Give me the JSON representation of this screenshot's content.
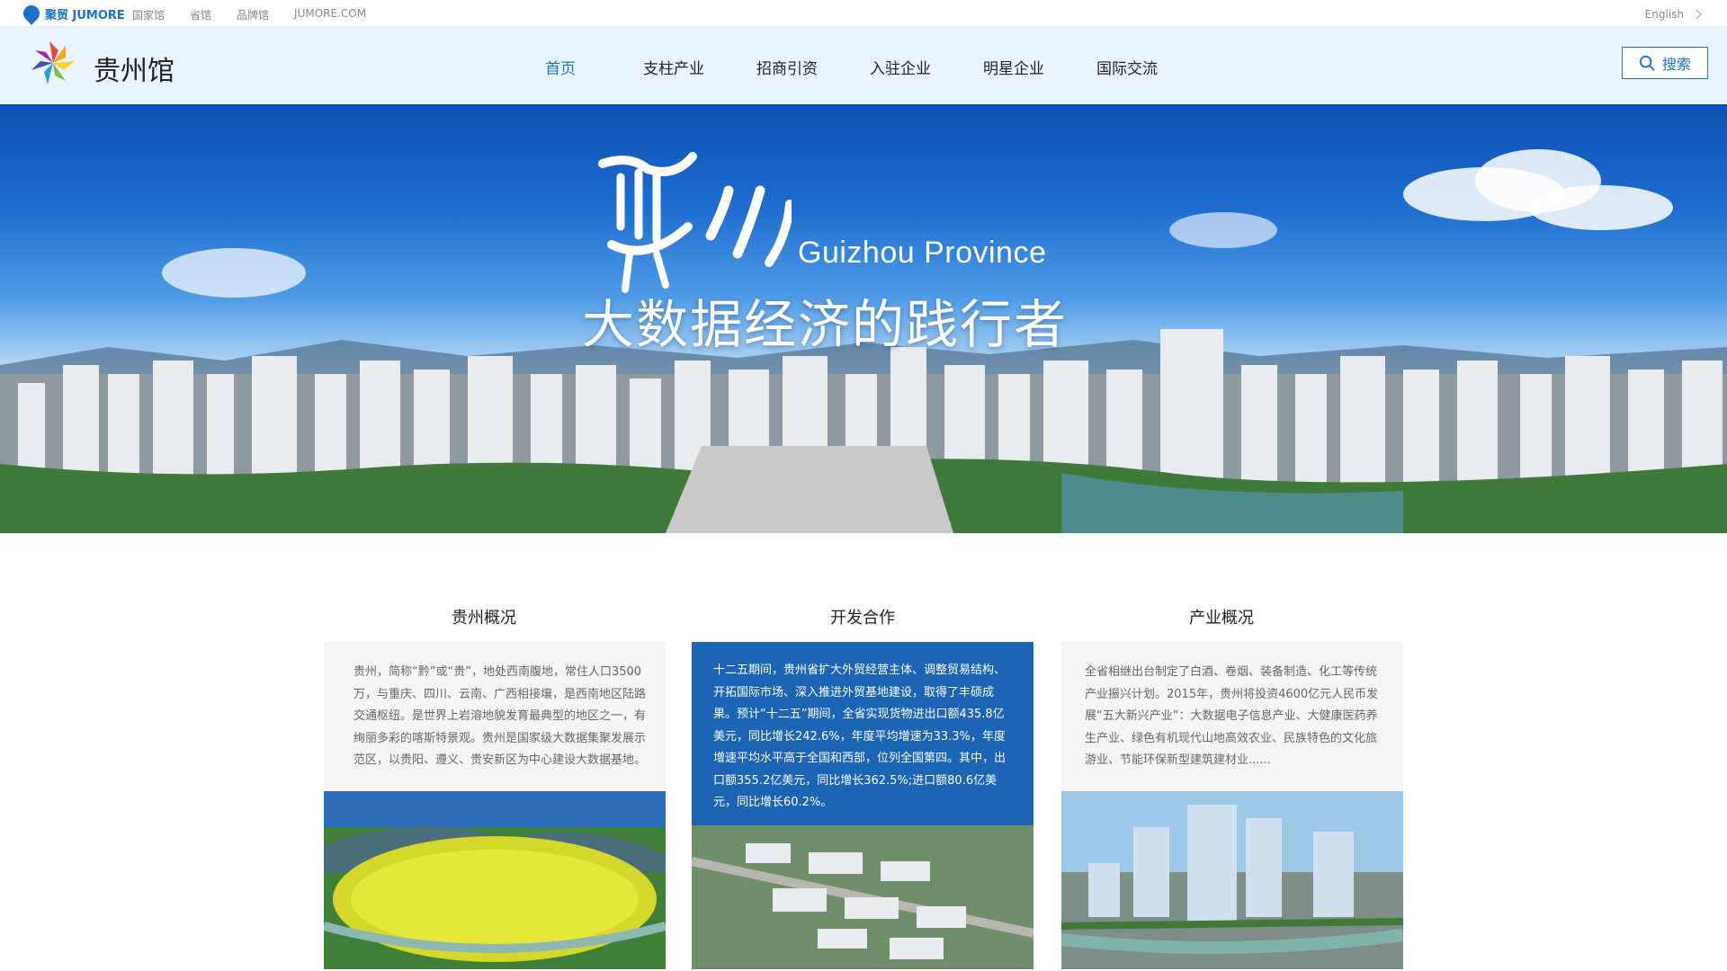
{
  "topbar": {
    "brand": "聚贸 JUMORE",
    "links": [
      "国家馆",
      "省馆",
      "品牌馆",
      "JUMORE.COM"
    ],
    "language": "English"
  },
  "header": {
    "site_title": "贵州馆",
    "nav": [
      "首页",
      "支柱产业",
      "招商引资",
      "入驻企业",
      "明星企业",
      "国际交流"
    ],
    "active_nav": "首页",
    "search_label": "搜索"
  },
  "hero": {
    "english_title": "Guizhou Province",
    "chinese_slogan": "大数据经济的践行者"
  },
  "sections": [
    {
      "title": "贵州概况",
      "text": "贵州，简称“黔”或“贵”，地处西南腹地，常住人口3500万，与重庆、四川、云南、广西相接壤，是西南地区陆路交通枢纽。是世界上岩溶地貌发育最典型的地区之一，有绚丽多彩的喀斯特景观。贵州是国家级大数据集聚发展示范区，以贵阳、遵义、贵安新区为中心建设大数据基地。"
    },
    {
      "title": "开发合作",
      "text": "十二五期间，贵州省扩大外贸经营主体、调整贸易结构、开拓国际市场、深入推进外贸基地建设，取得了丰硕成果。预计“十二五”期间，全省实现货物进出口额435.8亿美元，同比增长242.6%，年度平均增速为33.3%，年度增速平均水平高于全国和西部，位列全国第四。其中，出口额355.2亿美元，同比增长362.5%;进口额80.6亿美元，同比增长60.2%。"
    },
    {
      "title": "产业概况",
      "text": "全省相继出台制定了白酒、卷烟、装备制造、化工等传统产业振兴计划。2015年，贵州将投资4600亿元人民币发展“五大新兴产业”：大数据电子信息产业、大健康医药养生产业、绿色有机现代山地高效农业、民族特色的文化旅游业、节能环保新型建筑建材业......"
    }
  ],
  "colors": {
    "accent": "#1a73c9",
    "header_bg": "#eaf4fd",
    "card_blue": "#1d64b5"
  }
}
